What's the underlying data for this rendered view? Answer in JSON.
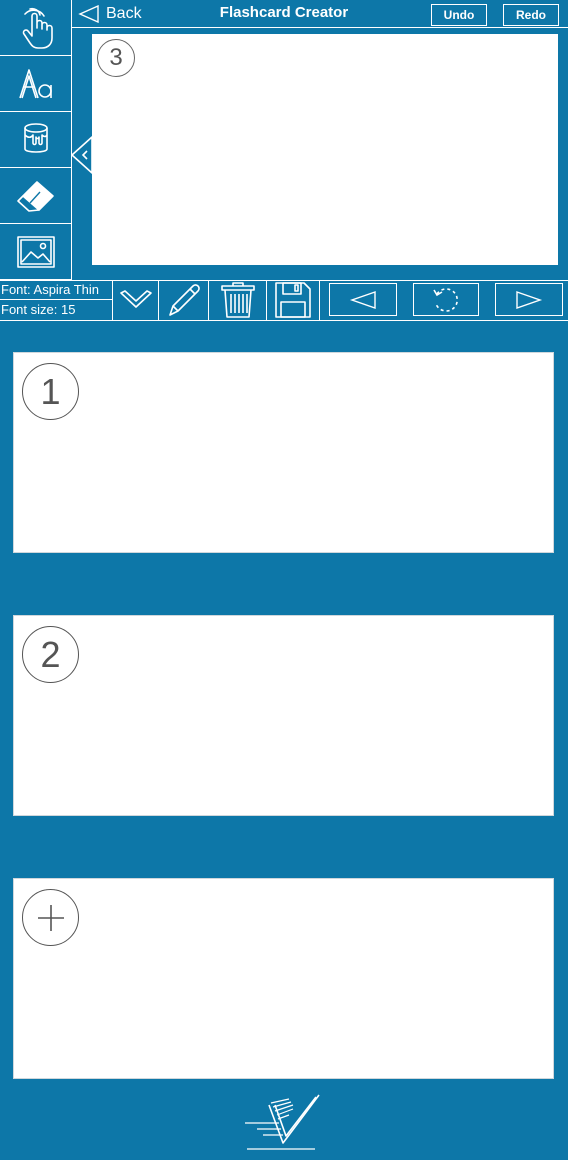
{
  "header": {
    "back_label": "Back",
    "title": "Flashcard Creator",
    "undo_label": "Undo",
    "redo_label": "Redo"
  },
  "tools": [
    {
      "icon": "hand-pointer-icon"
    },
    {
      "icon": "text-font-icon"
    },
    {
      "icon": "paint-bucket-icon"
    },
    {
      "icon": "eraser-icon"
    },
    {
      "icon": "image-icon"
    }
  ],
  "preview": {
    "number": "3"
  },
  "toolbar": {
    "font_label": "Font: Aspira Thin",
    "size_label": "Font size: 15",
    "buttons": [
      "chevron-down-icon",
      "pencil-icon",
      "trash-icon",
      "save-icon",
      "previous-icon",
      "rotate-icon",
      "next-icon"
    ]
  },
  "cards": [
    {
      "badge": "1"
    },
    {
      "badge": "2"
    },
    {
      "badge": "+"
    }
  ],
  "colors": {
    "background": "#0d77a8",
    "card": "#ffffff",
    "line": "#ffffff"
  }
}
